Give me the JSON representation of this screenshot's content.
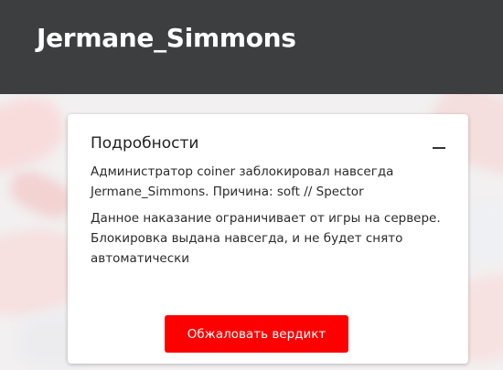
{
  "header": {
    "title": "Jermane_Simmons"
  },
  "card": {
    "title": "Подробности",
    "collapse_icon": "minus-icon",
    "paragraphs": [
      "Администратор coiner заблокировал навсегда Jermane_Simmons. Причина: soft // Spector",
      "Данное наказание ограничивает от игры на сервере. Блокировка выдана навсегда, и не будет снято автоматически"
    ],
    "appeal_button": "Обжаловать вердикт"
  },
  "colors": {
    "header_bg": "#3d3e40",
    "accent": "#ff0000",
    "card_bg": "#ffffff"
  }
}
